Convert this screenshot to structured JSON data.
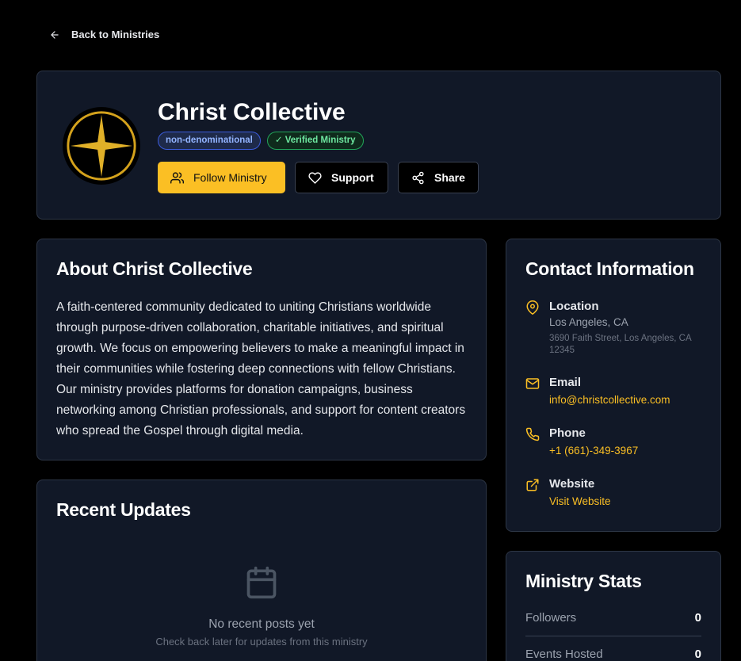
{
  "nav": {
    "back_label": "Back to Ministries"
  },
  "ministry": {
    "name": "Christ Collective",
    "badges": {
      "denomination": "non-denominational",
      "verified": "✓ Verified Ministry"
    },
    "actions": {
      "follow": "Follow Ministry",
      "support": "Support",
      "share": "Share"
    }
  },
  "about": {
    "title": "About Christ Collective",
    "text": "A faith-centered community dedicated to uniting Christians worldwide through purpose-driven collaboration, charitable initiatives, and spiritual growth. We focus on empowering believers to make a meaningful impact in their communities while fostering deep connections with fellow Christians. Our ministry provides platforms for donation campaigns, business networking among Christian professionals, and support for content creators who spread the Gospel through digital media."
  },
  "updates": {
    "title": "Recent Updates",
    "empty_title": "No recent posts yet",
    "empty_subtitle": "Check back later for updates from this ministry"
  },
  "contact": {
    "title": "Contact Information",
    "location_label": "Location",
    "location_city": "Los Angeles, CA",
    "location_address": "3690 Faith Street, Los Angeles, CA 12345",
    "email_label": "Email",
    "email_value": "info@christcollective.com",
    "phone_label": "Phone",
    "phone_value": "+1 (661)-349-3967",
    "website_label": "Website",
    "website_value": "Visit Website"
  },
  "stats": {
    "title": "Ministry Stats",
    "rows": [
      {
        "label": "Followers",
        "value": "0"
      },
      {
        "label": "Events Hosted",
        "value": "0"
      }
    ]
  },
  "colors": {
    "accent": "#fbbf24",
    "card_bg": "#111827",
    "page_bg": "#000000",
    "verified": "#22a55a",
    "denomination": "#3b5bdb"
  },
  "icons": [
    "arrow-left-icon",
    "star-logo-icon",
    "users-icon",
    "heart-icon",
    "share-icon",
    "map-pin-icon",
    "mail-icon",
    "phone-icon",
    "external-link-icon",
    "calendar-icon"
  ]
}
